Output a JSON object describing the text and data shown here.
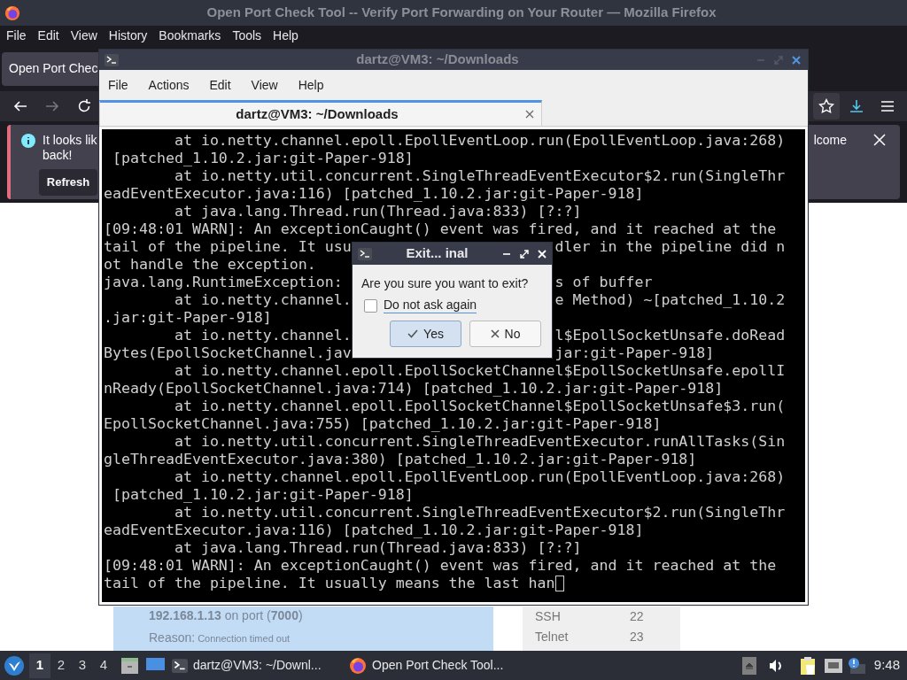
{
  "firefox": {
    "title": "Open Port Check Tool -- Verify Port Forwarding on Your Router — Mozilla Firefox",
    "menu": [
      "File",
      "Edit",
      "View",
      "History",
      "Bookmarks",
      "Tools",
      "Help"
    ],
    "tab": "Open Port Chec",
    "notification": {
      "text_left": "It looks lik",
      "text_right": "lcome",
      "text_line2": "back!",
      "button": "Refresh"
    },
    "page": {
      "result": "**192.168.1.13** on port (**7000**)",
      "reason_label": "Reason:",
      "reason": "Connection timed out",
      "ports": [
        {
          "service": "SSH",
          "port": "22"
        },
        {
          "service": "Telnet",
          "port": "23"
        }
      ]
    }
  },
  "terminal": {
    "title": "dartz@VM3: ~/Downloads",
    "menu": [
      "File",
      "Actions",
      "Edit",
      "View",
      "Help"
    ],
    "tabs": [
      {
        "label": "dartz@VM3: ~/Downloads",
        "selected": true
      }
    ],
    "lines": [
      {
        "kind": "full",
        "text": "        at io.netty.channel.epoll.EpollEventLoop.run(EpollEventLoop.java:268)"
      },
      {
        "kind": "full",
        "text": " [patched_1.10.2.jar:git-Paper-918]"
      },
      {
        "kind": "full",
        "text": "        at io.netty.util.concurrent.SingleThreadEventExecutor$2.run(SingleThr"
      },
      {
        "kind": "full",
        "text": "eadEventExecutor.java:116) [patched_1.10.2.jar:git-Paper-918]"
      },
      {
        "kind": "full",
        "text": "        at java.lang.Thread.run(Thread.java:833) [?:?]"
      },
      {
        "kind": "full",
        "text": "[09:48:01 WARN]: An exceptionCaught() event was fired, and it reached at the"
      },
      {
        "kind": "split",
        "left": "tail of the pipeline. It usu",
        "right": "dler in the pipeline did n"
      },
      {
        "kind": "full",
        "text": "ot handle the exception."
      },
      {
        "kind": "split",
        "left": "java.lang.RuntimeException:",
        "right": "s of buffer"
      },
      {
        "kind": "split",
        "left": "        at io.netty.channel.",
        "right": "e Method) ~[patched_1.10.2"
      },
      {
        "kind": "full",
        "text": ".jar:git-Paper-918]"
      },
      {
        "kind": "split",
        "left": "        at io.netty.channel.",
        "right": "l$EpollSocketUnsafe.doRead"
      },
      {
        "kind": "split",
        "left": "Bytes(EpollSocketChannel.jav",
        "right": "jar:git-Paper-918]"
      },
      {
        "kind": "full",
        "text": "        at io.netty.channel.epoll.EpollSocketChannel$EpollSocketUnsafe.epollI"
      },
      {
        "kind": "full",
        "text": "nReady(EpollSocketChannel.java:714) [patched_1.10.2.jar:git-Paper-918]"
      },
      {
        "kind": "full",
        "text": "        at io.netty.channel.epoll.EpollSocketChannel$EpollSocketUnsafe$3.run("
      },
      {
        "kind": "full",
        "text": "EpollSocketChannel.java:755) [patched_1.10.2.jar:git-Paper-918]"
      },
      {
        "kind": "full",
        "text": "        at io.netty.util.concurrent.SingleThreadEventExecutor.runAllTasks(Sin"
      },
      {
        "kind": "full",
        "text": "gleThreadEventExecutor.java:380) [patched_1.10.2.jar:git-Paper-918]"
      },
      {
        "kind": "full",
        "text": "        at io.netty.channel.epoll.EpollEventLoop.run(EpollEventLoop.java:268)"
      },
      {
        "kind": "full",
        "text": " [patched_1.10.2.jar:git-Paper-918]"
      },
      {
        "kind": "full",
        "text": "        at io.netty.util.concurrent.SingleThreadEventExecutor$2.run(SingleThr"
      },
      {
        "kind": "full",
        "text": "eadEventExecutor.java:116) [patched_1.10.2.jar:git-Paper-918]"
      },
      {
        "kind": "full",
        "text": "        at java.lang.Thread.run(Thread.java:833) [?:?]"
      },
      {
        "kind": "full",
        "text": "[09:48:01 WARN]: An exceptionCaught() event was fired, and it reached at the"
      },
      {
        "kind": "full",
        "text": "tail of the pipeline. It usually means the last han"
      }
    ],
    "cursor": true
  },
  "dialog": {
    "title": "Exit... inal",
    "message": "Are you sure you want to exit?",
    "checkbox": {
      "label": "Do not ask again",
      "checked": false
    },
    "buttons": [
      {
        "label": "Yes",
        "kind": "confirm",
        "selected": true
      },
      {
        "label": "No",
        "kind": "cancel",
        "selected": false
      }
    ]
  },
  "taskbar": {
    "workspaces": [
      {
        "label": "1",
        "selected": true
      },
      {
        "label": "2",
        "selected": false
      },
      {
        "label": "3",
        "selected": false
      },
      {
        "label": "4",
        "selected": false
      }
    ],
    "tasks": [
      {
        "label": "dartz@VM3: ~/Downl...",
        "kind": "terminal"
      },
      {
        "label": "Open Port Check Tool...",
        "kind": "browser"
      }
    ],
    "clock": "9:48"
  }
}
